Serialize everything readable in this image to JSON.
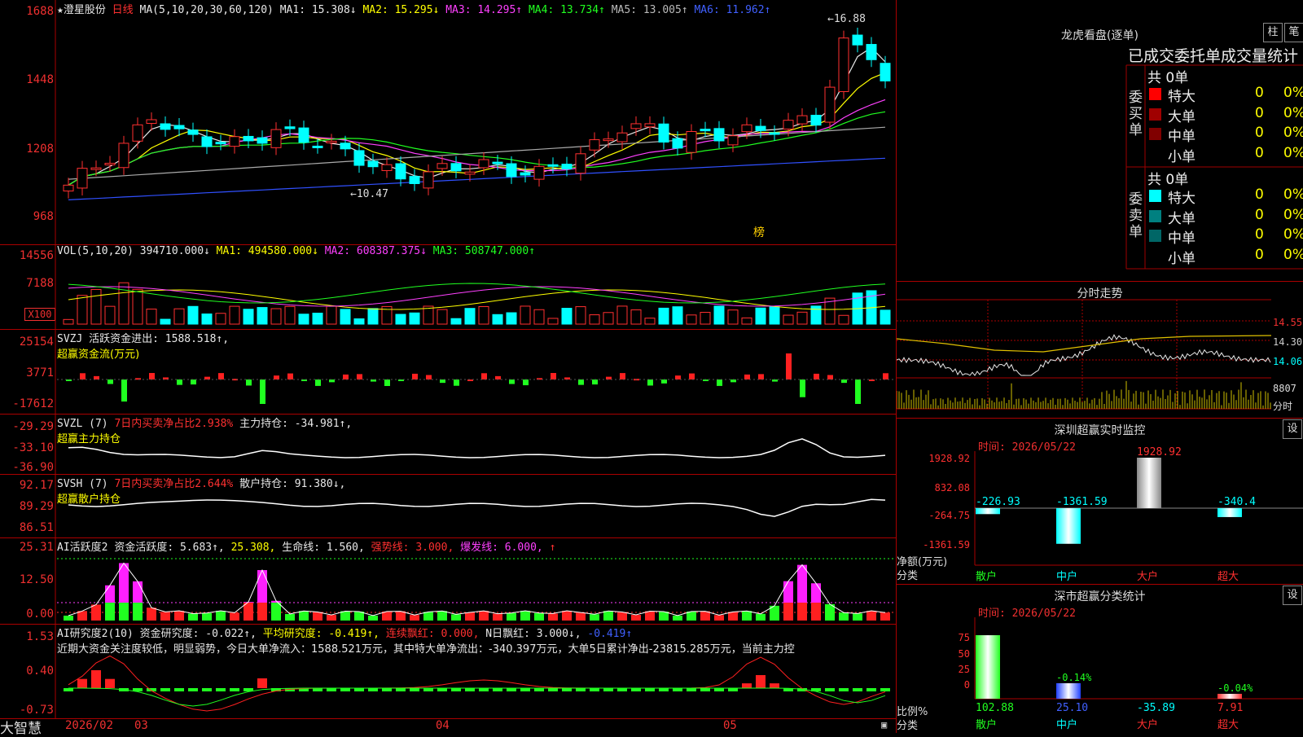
{
  "app_name": "大智慧",
  "main": {
    "stock_name": "澄星股份",
    "period": "日线",
    "ma_label": "MA(5,10,20,30,60,120)",
    "ma": [
      {
        "label": "MA1: 15.308↓",
        "color": "#e8e8e8"
      },
      {
        "label": "MA2: 15.295↓",
        "color": "#ffff00"
      },
      {
        "label": "MA3: 14.295↑",
        "color": "#ff40ff"
      },
      {
        "label": "MA4: 13.734↑",
        "color": "#20ff20"
      },
      {
        "label": "MA5: 13.005↑",
        "color": "#bbbbbb"
      },
      {
        "label": "MA6: 11.962↑",
        "color": "#4060ff"
      }
    ],
    "y_ticks": [
      "1688",
      "1448",
      "1208",
      "968"
    ],
    "high_label": "16.88",
    "low_label": "10.47",
    "bang_label": "榜"
  },
  "vol": {
    "header": "VOL(5,10,20)",
    "value": "394710.000↓",
    "ma": [
      {
        "label": "MA1: 494580.000↓",
        "color": "#ffff00"
      },
      {
        "label": "MA2: 608387.375↓",
        "color": "#ff40ff"
      },
      {
        "label": "MA3: 508747.000↑",
        "color": "#20ff20"
      }
    ],
    "y_ticks": [
      "14556",
      "7188",
      "X100"
    ]
  },
  "svzj": {
    "header": "SVZJ",
    "line1": "活跃资金进出: 1588.518↑,",
    "line2": "超赢资金流(万元)",
    "y_ticks": [
      "25154",
      "3771",
      "-17612"
    ]
  },
  "svzl": {
    "header": "SVZL (7)",
    "text1": "7日内买卖净占比2.938%",
    "text2": "主力持仓: -34.981↑,",
    "line2": "超赢主力持仓",
    "y_ticks": [
      "-29.29",
      "-33.10",
      "-36.90"
    ]
  },
  "svsh": {
    "header": "SVSH (7)",
    "text1": "7日内买卖净占比2.644%",
    "text2": "散户持仓: 91.380↓,",
    "line2": "超赢散户持仓",
    "y_ticks": [
      "92.17",
      "89.29",
      "86.51"
    ]
  },
  "ai_active": {
    "header": "AI活跃度2",
    "parts": [
      {
        "label": "资金活跃度: 5.683↑,",
        "color": "#e8e8e8"
      },
      {
        "label": "25.308,",
        "color": "#ffff00"
      },
      {
        "label": "生命线: 1.560,",
        "color": "#e8e8e8"
      },
      {
        "label": "强势线: 3.000,",
        "color": "#ff3030"
      },
      {
        "label": "爆发线: 6.000,",
        "color": "#ff40ff"
      }
    ],
    "arrow": "↑",
    "y_ticks": [
      "25.31",
      "12.50",
      "0.00"
    ]
  },
  "ai_research": {
    "header": "AI研究度2(10)",
    "parts": [
      {
        "label": "资金研究度: -0.022↑,",
        "color": "#e8e8e8"
      },
      {
        "label": "平均研究度: -0.419↑,",
        "color": "#ffff00"
      },
      {
        "label": "连续飘红: 0.000,",
        "color": "#ff3030"
      },
      {
        "label": "N日飘红: 3.000↓,",
        "color": "#e8e8e8"
      },
      {
        "label": "-0.419↑",
        "color": "#4060ff"
      }
    ],
    "comment": "近期大资金关注度较低，明显弱势，今日大单净流入：1588.521万元，其中特大单净流出：-340.397万元，大单5日累计净出-23815.285万元，当前主力控",
    "y_ticks": [
      "1.53",
      "0.40",
      "-0.73"
    ]
  },
  "x_axis": {
    "labels": [
      "2026/02",
      "03",
      "04",
      "05"
    ]
  },
  "dragon": {
    "title": "龙虎看盘(逐单)",
    "btn1": "柱",
    "btn2": "笔",
    "tabs_header": "已成交委托单成交量统计",
    "buy": {
      "side_label": "委买单",
      "total": "共 0单",
      "rows": [
        {
          "name": "特大",
          "value": "0",
          "pct": "0%",
          "color": "#ff0000"
        },
        {
          "name": "大单",
          "value": "0",
          "pct": "0%",
          "color": "#a00000"
        },
        {
          "name": "中单",
          "value": "0",
          "pct": "0%",
          "color": "#800000"
        },
        {
          "name": "小单",
          "value": "0",
          "pct": "0%",
          "color": ""
        }
      ]
    },
    "sell": {
      "side_label": "委卖单",
      "total": "共 0单",
      "rows": [
        {
          "name": "特大",
          "value": "0",
          "pct": "0%",
          "color": "#00ffff"
        },
        {
          "name": "大单",
          "value": "0",
          "pct": "0%",
          "color": "#008080"
        },
        {
          "name": "中单",
          "value": "0",
          "pct": "0%",
          "color": "#006666"
        },
        {
          "name": "小单",
          "value": "0",
          "pct": "0%",
          "color": ""
        }
      ]
    }
  },
  "intraday": {
    "title": "分时走势",
    "y_ticks": [
      "14.55",
      "14.30",
      "14.06"
    ],
    "vol_tick": "8807",
    "footer": "分时"
  },
  "sz_monitor": {
    "title": "深圳超赢实时监控",
    "btn": "设",
    "time": "时间: 2026/05/22",
    "y_ticks": [
      "1928.92",
      "832.08",
      "-264.75",
      "-1361.59"
    ],
    "ylabel": "净额(万元)",
    "xlabel": "分类",
    "bars": [
      {
        "cat": "散户",
        "value": "-226.93"
      },
      {
        "cat": "中户",
        "value": "-1361.59"
      },
      {
        "cat": "大户",
        "value": "1928.92"
      },
      {
        "cat": "超大",
        "value": "-340.4"
      }
    ]
  },
  "sz_class": {
    "title": "深市超赢分类统计",
    "btn": "设",
    "time": "时间: 2026/05/22",
    "y_ticks": [
      "75",
      "50",
      "25",
      "0"
    ],
    "ylabel": "比例%",
    "xlabel": "分类",
    "bars": [
      {
        "cat": "散户",
        "value": "102.88",
        "pct": ""
      },
      {
        "cat": "中户",
        "value": "25.10",
        "pct": "-0.14%"
      },
      {
        "cat": "大户",
        "value": "-35.89",
        "pct": ""
      },
      {
        "cat": "超大",
        "value": "7.91",
        "pct": "-0.04%"
      }
    ]
  },
  "chart_data": {
    "type": "candlestick",
    "title": "澄星股份 日线",
    "n_bars": 60,
    "price_ylim": [
      9.68,
      16.88
    ],
    "max_price": 16.88,
    "min_price": 10.47,
    "x_month_labels": [
      "2026/02",
      "03",
      "04",
      "05"
    ]
  }
}
